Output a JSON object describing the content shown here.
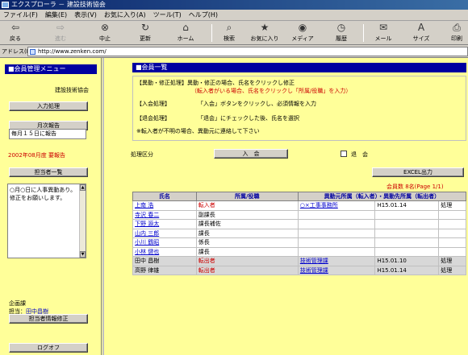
{
  "window": {
    "title": "エクスプローラ － 建設技術協会"
  },
  "menu": [
    "ファイル(F)",
    "編集(E)",
    "表示(V)",
    "お気に入り(A)",
    "ツール(T)",
    "ヘルプ(H)"
  ],
  "toolbar": {
    "back": "戻る",
    "forward": "進む",
    "stop": "中止",
    "refresh": "更新",
    "home": "ホーム",
    "search": "検索",
    "favorites": "お気に入り",
    "media": "メディア",
    "history": "履歴",
    "mail": "メール",
    "size": "サイズ",
    "print": "印刷"
  },
  "address": {
    "label": "アドレス(D)",
    "url": "http://www.zenken.com/"
  },
  "sidebar": {
    "title": "■会員管理メニュー",
    "org": "建設技術協会",
    "input_button": "入力処理",
    "monthly_button": "月次報告",
    "monthly_value": "毎月１５日に報告",
    "report_status": "2002年08月度 要報告",
    "manager_list_button": "担当者一覧",
    "memo": "○月○日に人事異動あり。修正をお願いします。",
    "dept": "企画課",
    "charge_label": "担当：",
    "charge_name": "田中昌樹",
    "manager_edit_button": "担当者情報修正",
    "logoff_button": "ログオフ"
  },
  "main": {
    "title": "■会員一覧",
    "info": {
      "line1": "【異動・修正処理】異動・修正の場合、氏名をクリックし修正",
      "line2": "（転入者がいる場合、氏名をクリックし「所属/役職」を入力）",
      "line3a": "【入会処理】",
      "line3b": "「入会」ボタンをクリックし、必須情報を入力",
      "line4a": "【退会処理】",
      "line4b": "「退会」にチェックした後、氏名を選択",
      "line5": "※転入者が不明の場合、異動元に連絡して下さい"
    },
    "proc_label": "処理区分",
    "join_button": "入　会",
    "leave_label": "退　会",
    "excel_button": "EXCEL出力",
    "count": "会員数 8名(Page 1/1)",
    "headers": [
      "氏名",
      "所属/役職",
      "異動元所属（転入者）・異動先所属（転出者）"
    ],
    "rows": [
      {
        "name": "上南 浩",
        "pos": "転入者",
        "from": "○×工事事務所",
        "date": "H15.01.14",
        "act": "処理"
      },
      {
        "name": "寺沢 春二",
        "pos": "副課長",
        "from": "",
        "date": "",
        "act": ""
      },
      {
        "name": "下野 源太",
        "pos": "課長補佐",
        "from": "",
        "date": "",
        "act": ""
      },
      {
        "name": "山内 三郎",
        "pos": "課長",
        "from": "",
        "date": "",
        "act": ""
      },
      {
        "name": "小川 鶴昭",
        "pos": "係長",
        "from": "",
        "date": "",
        "act": ""
      },
      {
        "name": "小林 健也",
        "pos": "課長",
        "from": "",
        "date": "",
        "act": ""
      },
      {
        "name": "田中 昌樹",
        "pos": "転出者",
        "from": "技術管理課",
        "date": "H15.01.10",
        "act": "処理"
      },
      {
        "name": "高野 律雄",
        "pos": "転出者",
        "from": "技術管理課",
        "date": "H15.01.14",
        "act": "処理"
      }
    ]
  }
}
